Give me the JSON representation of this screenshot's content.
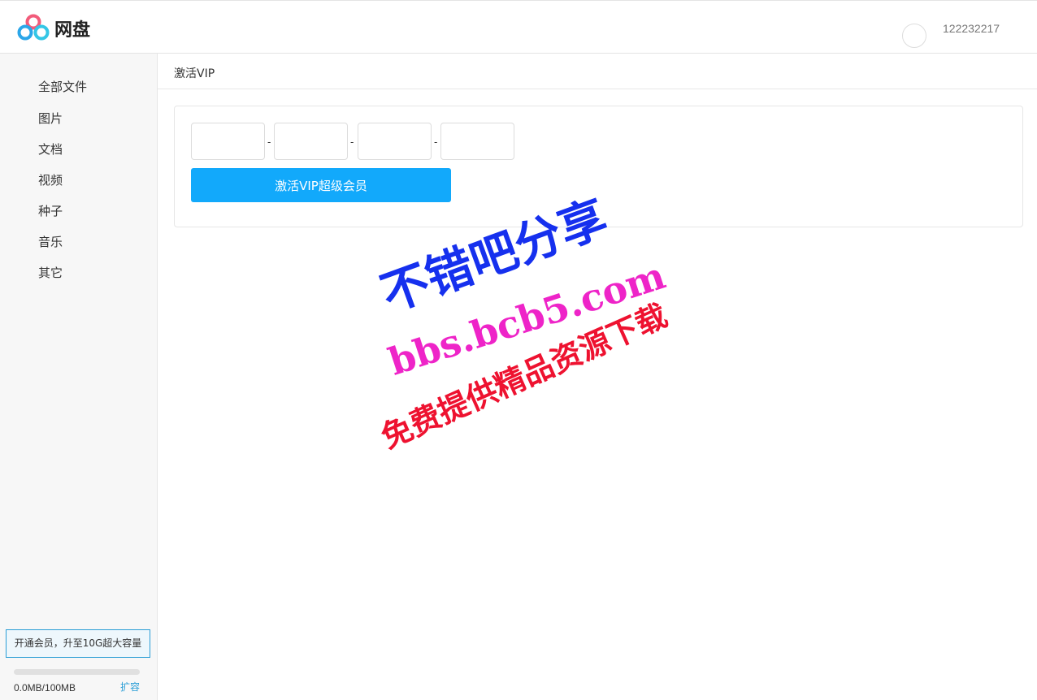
{
  "header": {
    "brand": "网盘",
    "username": "122232217"
  },
  "sidebar": {
    "items": [
      {
        "label": "全部文件"
      },
      {
        "label": "图片"
      },
      {
        "label": "文档"
      },
      {
        "label": "视频"
      },
      {
        "label": "种子"
      },
      {
        "label": "音乐"
      },
      {
        "label": "其它"
      }
    ],
    "promo_text": "开通会员，升至10G超大容量",
    "storage": {
      "used_fraction": 0,
      "text": "0.0MB/100MB",
      "expand_label": "扩容"
    }
  },
  "main": {
    "breadcrumb": "激活VIP",
    "code_inputs": [
      {
        "value": "",
        "placeholder": ""
      },
      {
        "value": "",
        "placeholder": ""
      },
      {
        "value": "",
        "placeholder": ""
      },
      {
        "value": "",
        "placeholder": ""
      }
    ],
    "separator": "-",
    "activate_label": "激活VIP超级会员"
  },
  "watermark": {
    "line1": "不错吧分享",
    "line2": "bbs.bcb5.com",
    "line3": "免费提供精品资源下载"
  },
  "colors": {
    "accent": "#12a9fb",
    "link": "#2b9ed6",
    "watermark1": "#1630ee",
    "watermark2": "#ee24c8",
    "watermark3": "#ee1230"
  }
}
